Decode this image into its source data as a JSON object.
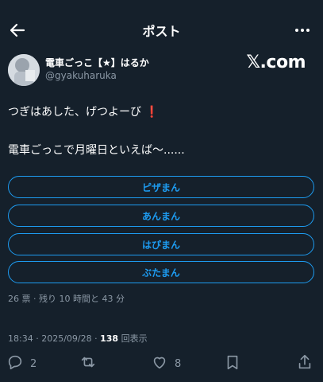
{
  "header": {
    "title": "ポスト"
  },
  "post": {
    "author_name": "電車ごっこ【★】はるか",
    "handle": "@gyakuharuka",
    "source_badge": "𝕏.com",
    "line1": "つぎはあした、げつよーび",
    "line1_emoji": "❗",
    "line2": "電車ごっこで月曜日といえば〜......"
  },
  "poll": {
    "options": [
      "ピザまん",
      "あんまん",
      "はぴまん",
      "ぶたまん"
    ],
    "summary": "26 票 · 残り 10 時間と 43 分"
  },
  "meta": {
    "time": "18:34",
    "date": "2025/09/28",
    "views": "138",
    "views_label": "回表示"
  },
  "actions": {
    "reply_count": "2",
    "retweet_count": "",
    "like_count": "8"
  },
  "colors": {
    "background": "#15202b",
    "accent": "#1d9bf0",
    "muted": "#8b98a5"
  }
}
